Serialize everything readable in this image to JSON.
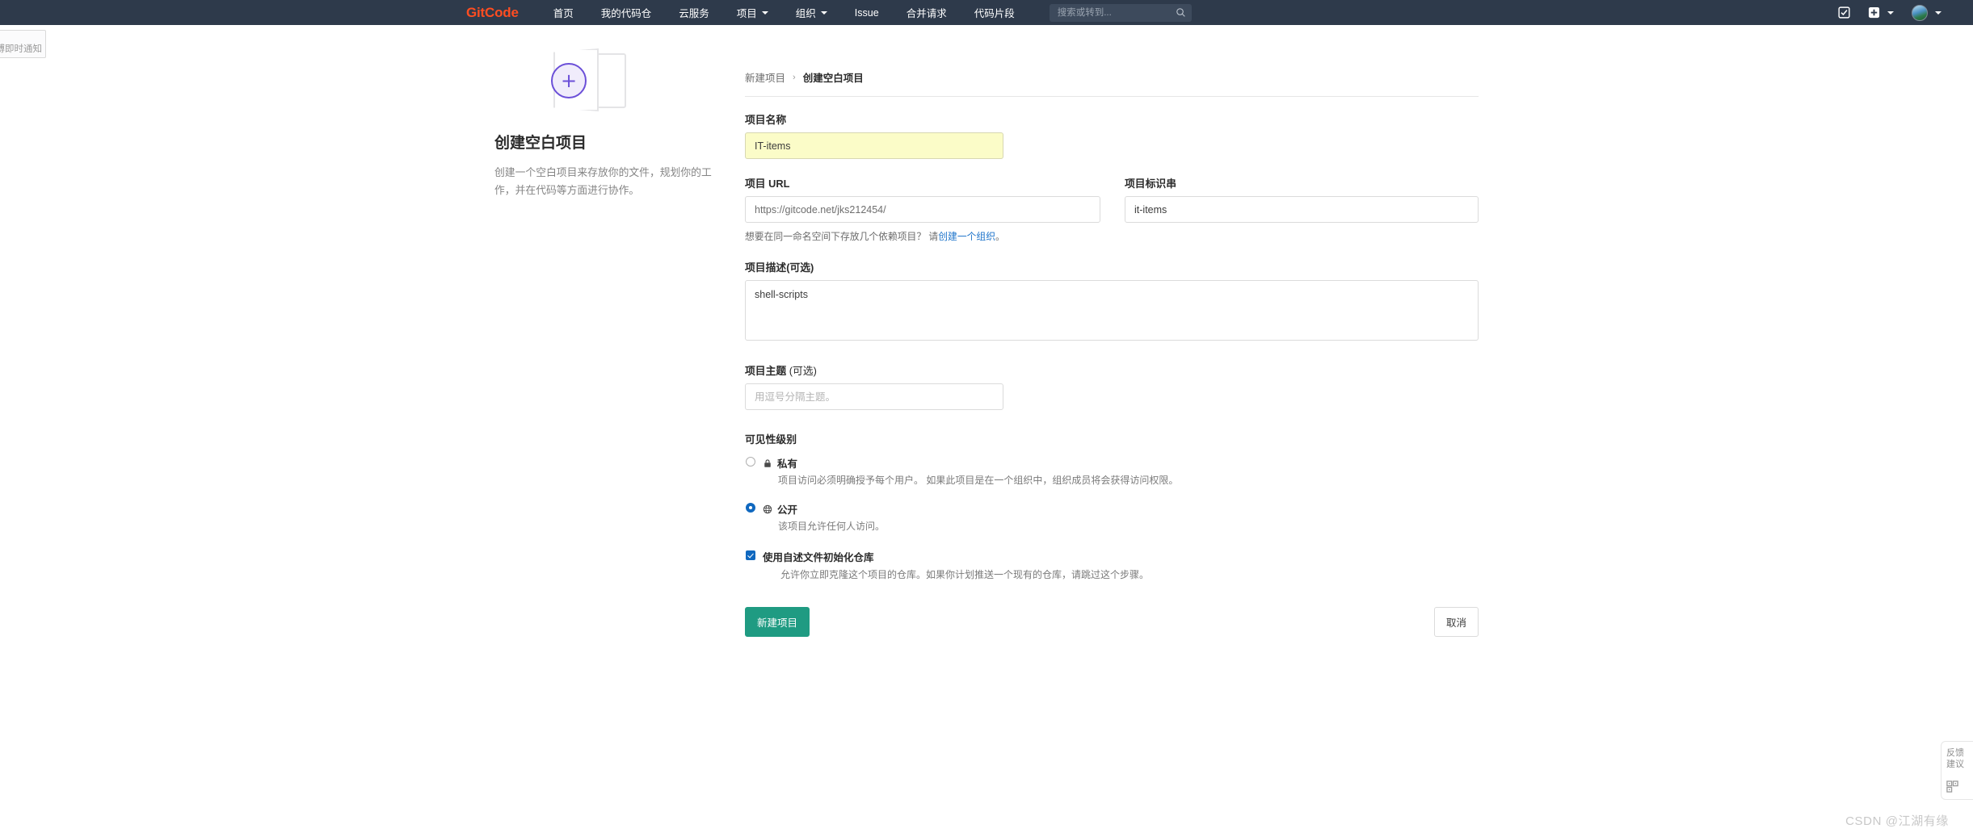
{
  "header": {
    "brand": "GitCode",
    "nav": [
      {
        "label": "首页",
        "has_caret": false
      },
      {
        "label": "我的代码仓",
        "has_caret": false
      },
      {
        "label": "云服务",
        "has_caret": false
      },
      {
        "label": "项目",
        "has_caret": true
      },
      {
        "label": "组织",
        "has_caret": true
      },
      {
        "label": "Issue",
        "has_caret": false
      },
      {
        "label": "合并请求",
        "has_caret": false
      },
      {
        "label": "代码片段",
        "has_caret": false
      }
    ],
    "search": {
      "placeholder": "搜索或转到...",
      "value": "",
      "icon": "search-icon"
    },
    "right_icons": [
      {
        "name": "todo-checkbox-icon"
      },
      {
        "name": "plus-icon"
      },
      {
        "name": "chevron-down-icon"
      },
      {
        "name": "user-avatar"
      },
      {
        "name": "chevron-down-icon"
      }
    ],
    "bg_color": "#2e3a4b",
    "brand_color": "#ff4d21"
  },
  "notification_panel": {
    "text": "微博即时通知"
  },
  "promo": {
    "title": "创建空白项目",
    "description": "创建一个空白项目来存放你的文件，规划你的工作，并在代码等方面进行协作。",
    "plus_glyph": "+",
    "accent_color": "#6b4fd8"
  },
  "breadcrumb": {
    "parent": "新建项目",
    "separator": "›",
    "current": "创建空白项目"
  },
  "form": {
    "name": {
      "label": "项目名称",
      "value": "IT-items",
      "autofill_color": "#fbfcc8"
    },
    "url": {
      "label": "项目 URL",
      "value": "https://gitcode.net/jks212454/"
    },
    "slug": {
      "label": "项目标识串",
      "value": "it-items"
    },
    "namespace_hint": {
      "text_before": "想要在同一命名空间下存放几个依赖项目？ 请",
      "link": "创建一个组织",
      "text_after": "。",
      "link_color": "#1f75cb"
    },
    "description": {
      "label": "项目描述(可选)",
      "value": "shell-scripts"
    },
    "topics": {
      "label_bold": "项目主题",
      "label_normal": " (可选)",
      "placeholder": "用逗号分隔主题。",
      "value": ""
    },
    "visibility": {
      "title": "可见性级别",
      "options": [
        {
          "label": "私有",
          "icon": "lock-icon",
          "description": "项目访问必须明确授予每个用户。 如果此项目是在一个组织中，组织成员将会获得访问权限。",
          "selected": false
        },
        {
          "label": "公开",
          "icon": "globe-icon",
          "description": "该项目允许任何人访问。",
          "selected": true
        }
      ]
    },
    "readme": {
      "label": "使用自述文件初始化仓库",
      "description": "允许你立即克隆这个项目的仓库。如果你计划推送一个现有的仓库，请跳过这个步骤。",
      "checked": true
    },
    "submit_label": "新建项目",
    "cancel_label": "取消",
    "submit_color": "#1f9b82"
  },
  "side_widget": {
    "line1": "反馈",
    "line2": "建议",
    "qr_icon": "qr-code-icon"
  },
  "watermark": "CSDN @江湖有缘"
}
